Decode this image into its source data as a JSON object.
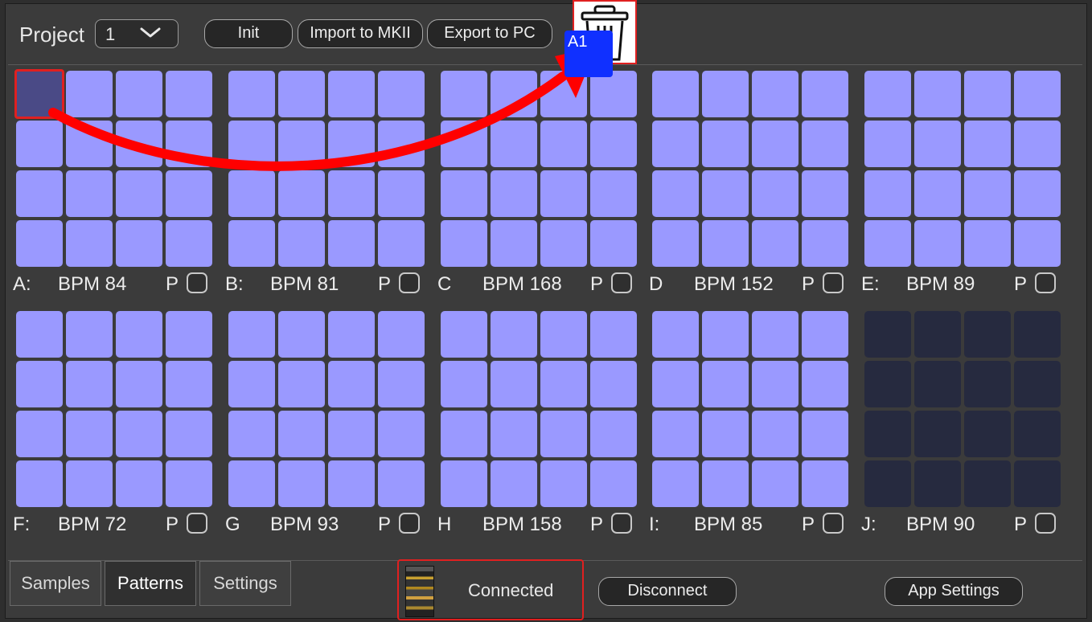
{
  "toolbar": {
    "project_label": "Project",
    "project_value": "1",
    "init_label": "Init",
    "import_label": "Import to MKII",
    "export_label": "Export to PC",
    "trash_icon": "trash-icon"
  },
  "drag": {
    "label": "A1"
  },
  "banks": [
    {
      "letter": "A:",
      "bpm": "BPM 84",
      "p": "P",
      "active": true
    },
    {
      "letter": "B:",
      "bpm": "BPM 81",
      "p": "P",
      "active": true
    },
    {
      "letter": "C",
      "bpm": "BPM 168",
      "p": "P",
      "active": true
    },
    {
      "letter": "D",
      "bpm": "BPM 152",
      "p": "P",
      "active": true
    },
    {
      "letter": "E:",
      "bpm": "BPM 89",
      "p": "P",
      "active": true
    },
    {
      "letter": "F:",
      "bpm": "BPM 72",
      "p": "P",
      "active": true
    },
    {
      "letter": "G",
      "bpm": "BPM 93",
      "p": "P",
      "active": true
    },
    {
      "letter": "H",
      "bpm": "BPM 158",
      "p": "P",
      "active": true
    },
    {
      "letter": "I:",
      "bpm": "BPM 85",
      "p": "P",
      "active": true
    },
    {
      "letter": "J:",
      "bpm": "BPM 90",
      "p": "P",
      "active": false
    }
  ],
  "tabs": [
    "Samples",
    "Patterns",
    "Settings"
  ],
  "active_tab": "Patterns",
  "status": {
    "connected_label": "Connected",
    "disconnect_label": "Disconnect",
    "app_settings_label": "App Settings"
  },
  "colors": {
    "pad": "#9a99ff",
    "pad_empty": "#262a3f",
    "highlight": "#e02020",
    "drag_chip": "#1030ff"
  }
}
